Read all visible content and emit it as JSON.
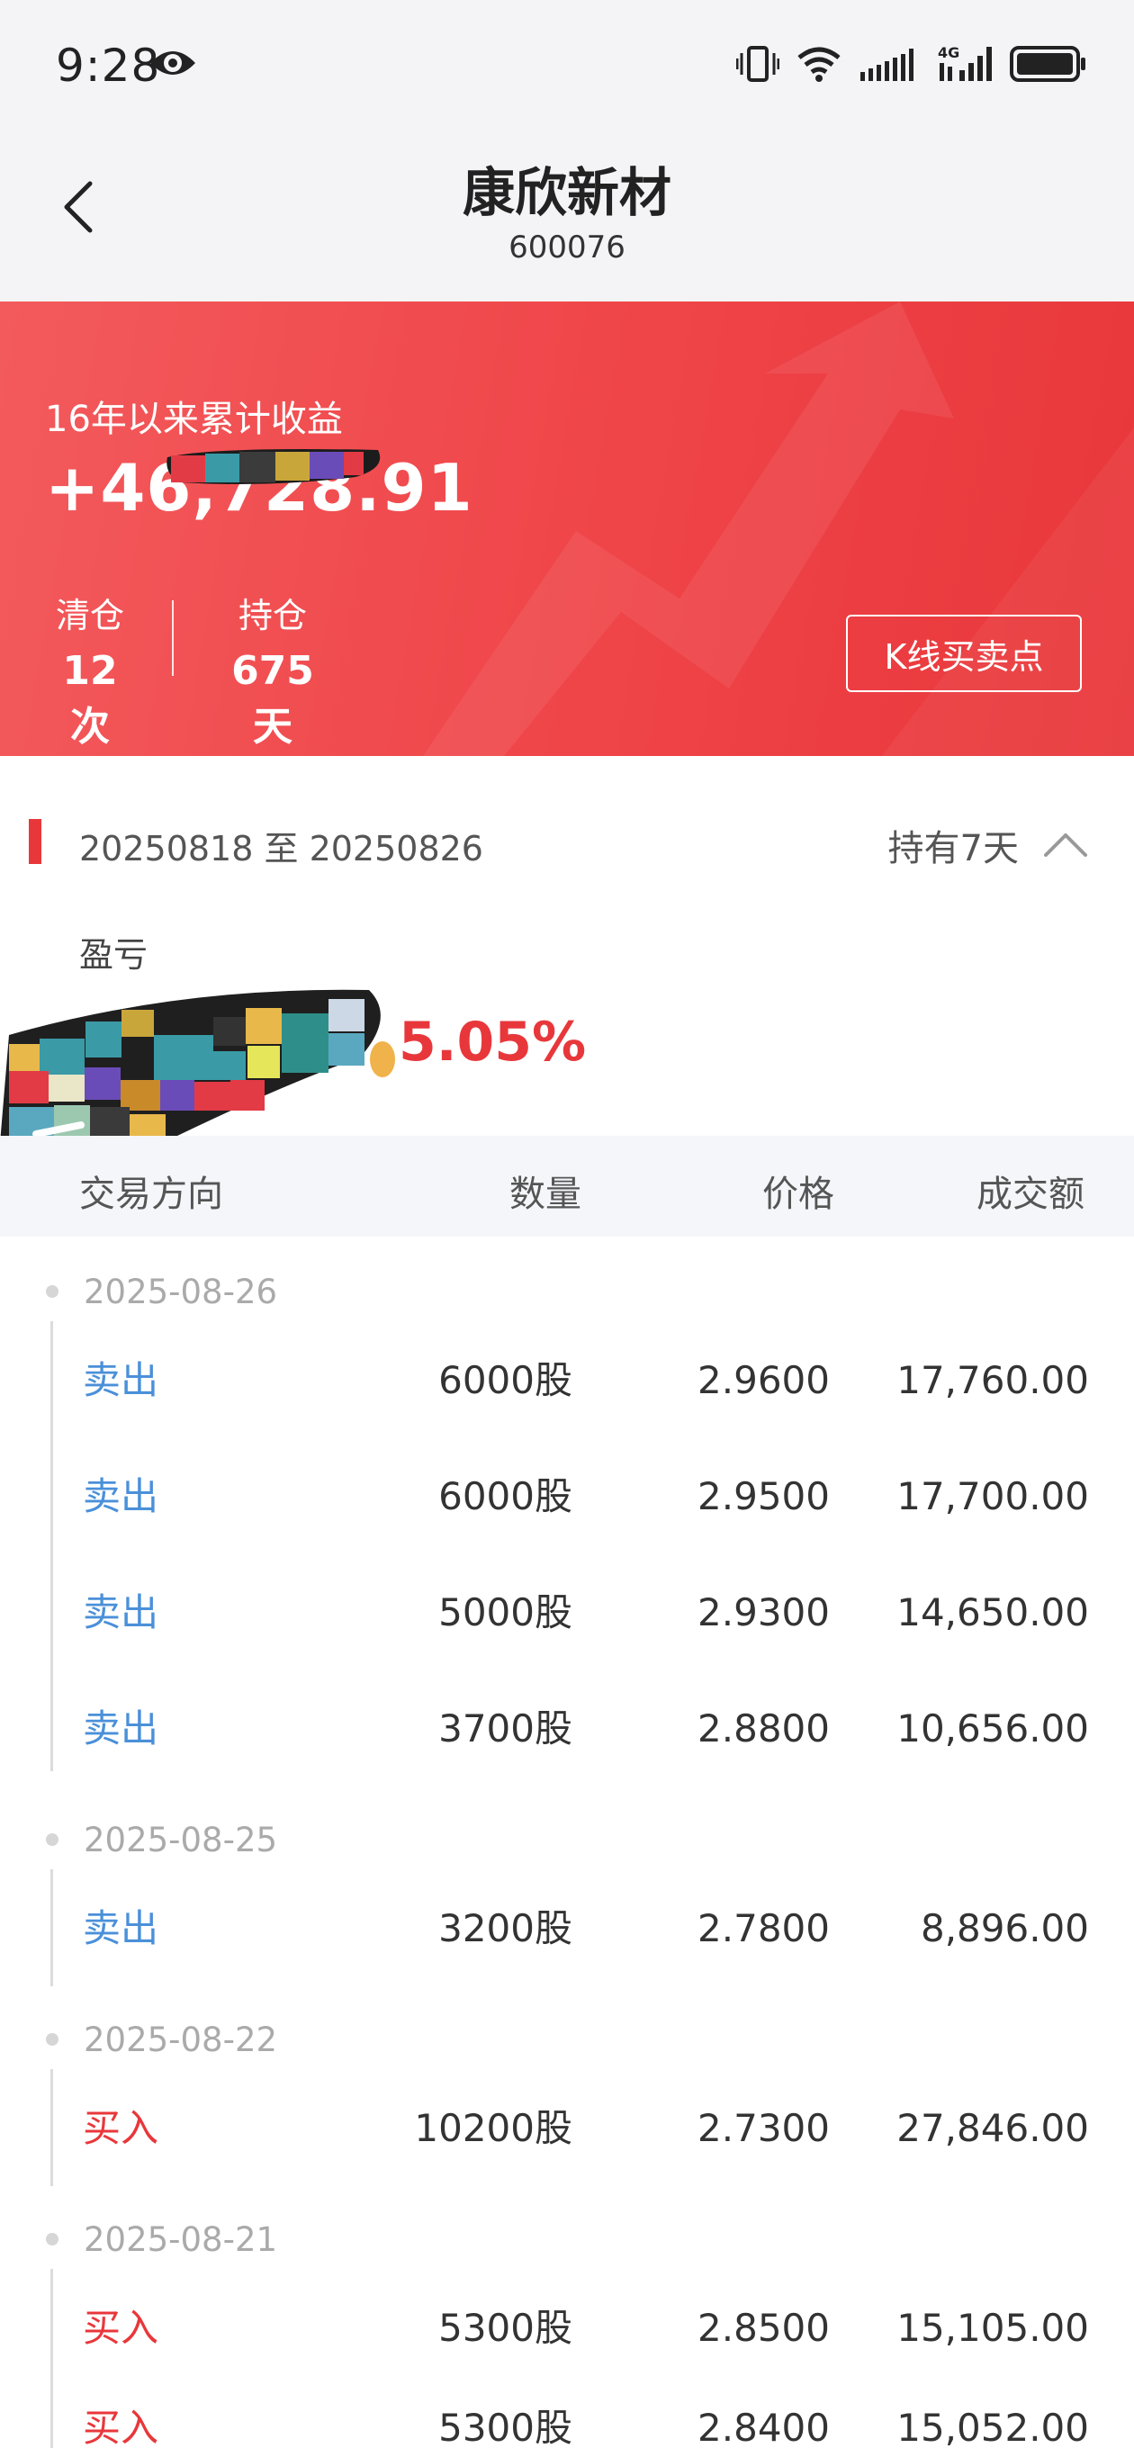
{
  "status_bar": {
    "time": "9:28",
    "icons": [
      "eye-icon",
      "vibrate-icon",
      "wifi-icon",
      "signal-icon",
      "4g-signal-icon",
      "battery-icon"
    ],
    "network_label": "4G"
  },
  "header": {
    "title": "康欣新材",
    "code": "600076",
    "back_icon": "back-icon"
  },
  "banner": {
    "label": "16年以来累计收益",
    "value": "+46,728.91",
    "stats": {
      "clear_label": "清仓",
      "clear_value": "12次",
      "hold_label": "持仓",
      "hold_value": "675天"
    },
    "kline_button": "K线买卖点",
    "color": "#ef4448"
  },
  "period": {
    "range": "20250818 至 20250826",
    "hold_text": "持有7天",
    "pl_label": "盈亏",
    "pl_value": "5.05%"
  },
  "table": {
    "headers": {
      "direction": "交易方向",
      "quantity": "数量",
      "price": "价格",
      "amount": "成交额"
    },
    "groups": [
      {
        "date": "2025-08-26",
        "rows": [
          {
            "dir": "卖出",
            "type": "sell",
            "qty": "6000股",
            "price": "2.9600",
            "amount": "17,760.00"
          },
          {
            "dir": "卖出",
            "type": "sell",
            "qty": "6000股",
            "price": "2.9500",
            "amount": "17,700.00"
          },
          {
            "dir": "卖出",
            "type": "sell",
            "qty": "5000股",
            "price": "2.9300",
            "amount": "14,650.00"
          },
          {
            "dir": "卖出",
            "type": "sell",
            "qty": "3700股",
            "price": "2.8800",
            "amount": "10,656.00"
          }
        ]
      },
      {
        "date": "2025-08-25",
        "rows": [
          {
            "dir": "卖出",
            "type": "sell",
            "qty": "3200股",
            "price": "2.7800",
            "amount": "8,896.00"
          }
        ]
      },
      {
        "date": "2025-08-22",
        "rows": [
          {
            "dir": "买入",
            "type": "buy",
            "qty": "10200股",
            "price": "2.7300",
            "amount": "27,846.00"
          }
        ]
      },
      {
        "date": "2025-08-21",
        "rows": [
          {
            "dir": "买入",
            "type": "buy",
            "qty": "5300股",
            "price": "2.8500",
            "amount": "15,105.00"
          },
          {
            "dir": "买入",
            "type": "buy",
            "qty": "5300股",
            "price": "2.8400",
            "amount": "15,052.00"
          }
        ]
      }
    ],
    "sell_color": "#4a90d9",
    "buy_color": "#e8373b"
  }
}
